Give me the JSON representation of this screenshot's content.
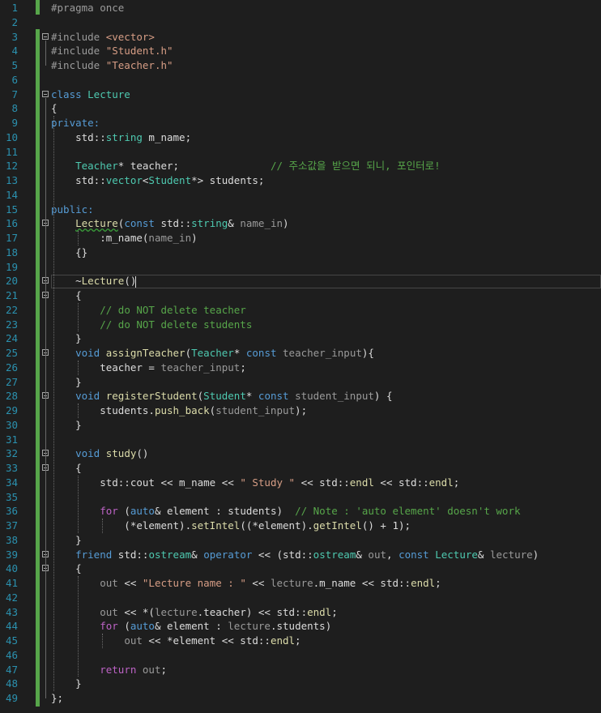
{
  "editor": {
    "language": "C++",
    "theme": "dark",
    "line_numbers": [
      "1",
      "2",
      "3",
      "4",
      "5",
      "6",
      "7",
      "8",
      "9",
      "10",
      "11",
      "12",
      "13",
      "14",
      "15",
      "16",
      "17",
      "18",
      "19",
      "20",
      "21",
      "22",
      "23",
      "24",
      "25",
      "26",
      "27",
      "28",
      "29",
      "30",
      "31",
      "32",
      "33",
      "34",
      "35",
      "36",
      "37",
      "38",
      "39",
      "40",
      "41",
      "42",
      "43",
      "44",
      "45",
      "46",
      "47",
      "48",
      "49"
    ],
    "current_line": "20",
    "colors": {
      "background": "#1e1e1e",
      "line_number": "#2b91af",
      "keyword": "#569cd6",
      "type": "#4ec9b0",
      "function": "#dcdcaa",
      "string": "#d69d85",
      "comment": "#57a64a",
      "member": "#9cdcfe",
      "change_bar": "#57a64a"
    },
    "lines": [
      [
        {
          "t": "#pragma once",
          "c": "pp"
        }
      ],
      [],
      [
        {
          "t": "#include ",
          "c": "pp"
        },
        {
          "t": "<vector>",
          "c": "st"
        }
      ],
      [
        {
          "t": "#include ",
          "c": "pp"
        },
        {
          "t": "\"Student.h\"",
          "c": "st"
        }
      ],
      [
        {
          "t": "#include ",
          "c": "pp"
        },
        {
          "t": "\"Teacher.h\"",
          "c": "st"
        }
      ],
      [],
      [
        {
          "t": "class ",
          "c": "kw"
        },
        {
          "t": "Lecture",
          "c": "ty"
        }
      ],
      [
        {
          "t": "{",
          "c": ""
        }
      ],
      [
        {
          "t": "private:",
          "c": "kw"
        }
      ],
      [
        {
          "t": "    std",
          "c": ""
        },
        {
          "t": "::",
          "c": ""
        },
        {
          "t": "string",
          "c": "ty"
        },
        {
          "t": " m_name;",
          "c": ""
        }
      ],
      [],
      [
        {
          "t": "    ",
          "c": ""
        },
        {
          "t": "Teacher",
          "c": "ty"
        },
        {
          "t": "* teacher;               ",
          "c": ""
        },
        {
          "t": "// 주소값을 받으면 되니, 포인터로!",
          "c": "cm"
        }
      ],
      [
        {
          "t": "    std::",
          "c": ""
        },
        {
          "t": "vector",
          "c": "ty"
        },
        {
          "t": "<",
          "c": ""
        },
        {
          "t": "Student",
          "c": "ty"
        },
        {
          "t": "*> students;",
          "c": ""
        }
      ],
      [],
      [
        {
          "t": "public:",
          "c": "kw"
        }
      ],
      [
        {
          "t": "    ",
          "c": ""
        },
        {
          "t": "Lecture",
          "c": "fn sq"
        },
        {
          "t": "(",
          "c": ""
        },
        {
          "t": "const ",
          "c": "kw"
        },
        {
          "t": "std::",
          "c": ""
        },
        {
          "t": "string",
          "c": "ty"
        },
        {
          "t": "& ",
          "c": ""
        },
        {
          "t": "name_in",
          "c": "pa"
        },
        {
          "t": ")",
          "c": ""
        }
      ],
      [
        {
          "t": "        :",
          "c": ""
        },
        {
          "t": "m_name",
          "c": ""
        },
        {
          "t": "(",
          "c": ""
        },
        {
          "t": "name_in",
          "c": "pa"
        },
        {
          "t": ")",
          "c": ""
        }
      ],
      [
        {
          "t": "    {}",
          "c": ""
        }
      ],
      [],
      [
        {
          "t": "    ~",
          "c": ""
        },
        {
          "t": "Lecture",
          "c": "fn"
        },
        {
          "t": "()",
          "c": ""
        }
      ],
      [
        {
          "t": "    {",
          "c": ""
        }
      ],
      [
        {
          "t": "        ",
          "c": ""
        },
        {
          "t": "// do NOT delete teacher",
          "c": "cm"
        }
      ],
      [
        {
          "t": "        ",
          "c": ""
        },
        {
          "t": "// do NOT delete students",
          "c": "cm"
        }
      ],
      [
        {
          "t": "    }",
          "c": ""
        }
      ],
      [
        {
          "t": "    ",
          "c": ""
        },
        {
          "t": "void ",
          "c": "kw"
        },
        {
          "t": "assignTeacher",
          "c": "fn"
        },
        {
          "t": "(",
          "c": ""
        },
        {
          "t": "Teacher",
          "c": "ty"
        },
        {
          "t": "* ",
          "c": ""
        },
        {
          "t": "const ",
          "c": "kw"
        },
        {
          "t": "teacher_input",
          "c": "pa"
        },
        {
          "t": "){",
          "c": ""
        }
      ],
      [
        {
          "t": "        ",
          "c": ""
        },
        {
          "t": "teacher",
          "c": ""
        },
        {
          "t": " = ",
          "c": ""
        },
        {
          "t": "teacher_input",
          "c": "pa"
        },
        {
          "t": ";",
          "c": ""
        }
      ],
      [
        {
          "t": "    }",
          "c": ""
        }
      ],
      [
        {
          "t": "    ",
          "c": ""
        },
        {
          "t": "void ",
          "c": "kw"
        },
        {
          "t": "registerStudent",
          "c": "fn"
        },
        {
          "t": "(",
          "c": ""
        },
        {
          "t": "Student",
          "c": "ty"
        },
        {
          "t": "* ",
          "c": ""
        },
        {
          "t": "const ",
          "c": "kw"
        },
        {
          "t": "student_input",
          "c": "pa"
        },
        {
          "t": ") {",
          "c": ""
        }
      ],
      [
        {
          "t": "        students.",
          "c": ""
        },
        {
          "t": "push_back",
          "c": "fn"
        },
        {
          "t": "(",
          "c": ""
        },
        {
          "t": "student_input",
          "c": "pa"
        },
        {
          "t": ");",
          "c": ""
        }
      ],
      [
        {
          "t": "    }",
          "c": ""
        }
      ],
      [],
      [
        {
          "t": "    ",
          "c": ""
        },
        {
          "t": "void ",
          "c": "kw"
        },
        {
          "t": "study",
          "c": "fn"
        },
        {
          "t": "()",
          "c": ""
        }
      ],
      [
        {
          "t": "    {",
          "c": ""
        }
      ],
      [
        {
          "t": "        std::",
          "c": ""
        },
        {
          "t": "cout",
          "c": ""
        },
        {
          "t": " << m_name << ",
          "c": ""
        },
        {
          "t": "\" Study \"",
          "c": "st"
        },
        {
          "t": " << std::",
          "c": ""
        },
        {
          "t": "endl",
          "c": "fn"
        },
        {
          "t": " << std::",
          "c": ""
        },
        {
          "t": "endl",
          "c": "fn"
        },
        {
          "t": ";",
          "c": ""
        }
      ],
      [],
      [
        {
          "t": "        ",
          "c": ""
        },
        {
          "t": "for ",
          "c": "mc"
        },
        {
          "t": "(",
          "c": ""
        },
        {
          "t": "auto",
          "c": "kw"
        },
        {
          "t": "& element : students)  ",
          "c": ""
        },
        {
          "t": "// Note : 'auto element' doesn't work",
          "c": "cm"
        }
      ],
      [
        {
          "t": "            (*element).",
          "c": ""
        },
        {
          "t": "setIntel",
          "c": "fn"
        },
        {
          "t": "((*element).",
          "c": ""
        },
        {
          "t": "getIntel",
          "c": "fn"
        },
        {
          "t": "() + 1);",
          "c": ""
        }
      ],
      [
        {
          "t": "    }",
          "c": ""
        }
      ],
      [
        {
          "t": "    ",
          "c": ""
        },
        {
          "t": "friend ",
          "c": "kw"
        },
        {
          "t": "std::",
          "c": ""
        },
        {
          "t": "ostream",
          "c": "ty"
        },
        {
          "t": "& ",
          "c": ""
        },
        {
          "t": "operator",
          "c": "kw"
        },
        {
          "t": " << (std::",
          "c": ""
        },
        {
          "t": "ostream",
          "c": "ty"
        },
        {
          "t": "& ",
          "c": ""
        },
        {
          "t": "out",
          "c": "pa"
        },
        {
          "t": ", ",
          "c": ""
        },
        {
          "t": "const ",
          "c": "kw"
        },
        {
          "t": "Lecture",
          "c": "ty"
        },
        {
          "t": "& ",
          "c": ""
        },
        {
          "t": "lecture",
          "c": "pa"
        },
        {
          "t": ")",
          "c": ""
        }
      ],
      [
        {
          "t": "    {",
          "c": ""
        }
      ],
      [
        {
          "t": "        ",
          "c": ""
        },
        {
          "t": "out",
          "c": "pa"
        },
        {
          "t": " << ",
          "c": ""
        },
        {
          "t": "\"Lecture name : \"",
          "c": "st"
        },
        {
          "t": " << ",
          "c": ""
        },
        {
          "t": "lecture",
          "c": "pa"
        },
        {
          "t": ".m_name << std::",
          "c": ""
        },
        {
          "t": "endl",
          "c": "fn"
        },
        {
          "t": ";",
          "c": ""
        }
      ],
      [],
      [
        {
          "t": "        ",
          "c": ""
        },
        {
          "t": "out",
          "c": "pa"
        },
        {
          "t": " << *(",
          "c": ""
        },
        {
          "t": "lecture",
          "c": "pa"
        },
        {
          "t": ".teacher) << std::",
          "c": ""
        },
        {
          "t": "endl",
          "c": "fn"
        },
        {
          "t": ";",
          "c": ""
        }
      ],
      [
        {
          "t": "        ",
          "c": ""
        },
        {
          "t": "for ",
          "c": "mc"
        },
        {
          "t": "(",
          "c": ""
        },
        {
          "t": "auto",
          "c": "kw"
        },
        {
          "t": "& element : ",
          "c": ""
        },
        {
          "t": "lecture",
          "c": "pa"
        },
        {
          "t": ".students)",
          "c": ""
        }
      ],
      [
        {
          "t": "            ",
          "c": ""
        },
        {
          "t": "out",
          "c": "pa"
        },
        {
          "t": " << *element << std::",
          "c": ""
        },
        {
          "t": "endl",
          "c": "fn"
        },
        {
          "t": ";",
          "c": ""
        }
      ],
      [],
      [
        {
          "t": "        ",
          "c": ""
        },
        {
          "t": "return ",
          "c": "mc"
        },
        {
          "t": "out",
          "c": "pa"
        },
        {
          "t": ";",
          "c": ""
        }
      ],
      [
        {
          "t": "    }",
          "c": ""
        }
      ],
      [
        {
          "t": "};",
          "c": ""
        }
      ]
    ]
  }
}
